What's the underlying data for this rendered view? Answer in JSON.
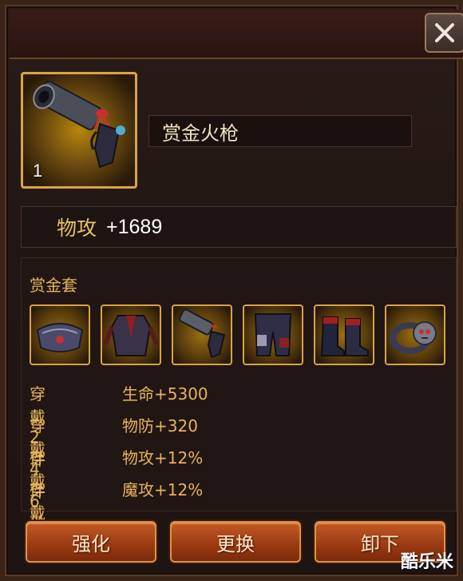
{
  "item": {
    "name": "赏金火枪",
    "count": "1",
    "icon": "flintlock-pistol-icon"
  },
  "stat": {
    "label": "物攻",
    "value": "+1689"
  },
  "set": {
    "title": "赏金套",
    "items": [
      {
        "icon": "shoulder-armor-icon"
      },
      {
        "icon": "chest-armor-icon"
      },
      {
        "icon": "flintlock-pistol-icon"
      },
      {
        "icon": "leg-armor-icon"
      },
      {
        "icon": "boots-icon"
      },
      {
        "icon": "skull-ring-icon"
      }
    ],
    "bonuses": [
      {
        "condition": "穿戴2件",
        "effect": "生命+5300"
      },
      {
        "condition": "穿戴4件",
        "effect": "物防+320"
      },
      {
        "condition": "穿戴6件",
        "effect": "物攻+12%"
      },
      {
        "condition": "穿戴6件",
        "effect": "魔攻+12%"
      }
    ]
  },
  "buttons": {
    "enhance": "强化",
    "replace": "更换",
    "unequip": "卸下"
  },
  "close_icon": "close-icon",
  "watermark": "酷乐米",
  "colors": {
    "gold_text": "#e8b45a",
    "button_orange": "#c25a26",
    "slot_border": "#d8a448"
  }
}
